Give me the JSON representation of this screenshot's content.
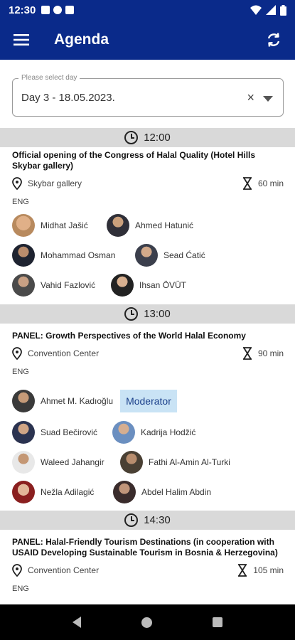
{
  "status": {
    "time": "12:30"
  },
  "app_bar": {
    "title": "Agenda",
    "menu_icon": "menu-icon",
    "refresh_icon": "refresh-icon"
  },
  "day_select": {
    "legend": "Please select day",
    "value": "Day 3 - 18.05.2023.",
    "clear": "×"
  },
  "sessions": [
    {
      "time": "12:00",
      "title": "Official opening of the Congress of Halal Quality (Hotel Hills Skybar gallery)",
      "location": "Skybar gallery",
      "duration": "60 min",
      "language": "ENG",
      "speakers": [
        {
          "name": "Midhat  Jašić"
        },
        {
          "name": "Ahmed  Hatunić"
        },
        {
          "name": "Mohammad  Osman"
        },
        {
          "name": "Sead Ćatić"
        },
        {
          "name": "Vahid Fazlović"
        },
        {
          "name": "Ihsan  ÖVÜT"
        }
      ]
    },
    {
      "time": "13:00",
      "title": "PANEL: Growth Perspectives of the World Halal Economy",
      "location": "Convention Center",
      "duration": "90 min",
      "language": "ENG",
      "moderator_label": "Moderator",
      "speakers": [
        {
          "name": "Ahmet M. Kadıoğlu"
        },
        {
          "name": "Suad Bečirović"
        },
        {
          "name": "Kadrija  Hodžić"
        },
        {
          "name": "Waleed Jahangir"
        },
        {
          "name": "Fathi Al-Amin  Al-Turki"
        },
        {
          "name": "Nežla  Adilagić"
        },
        {
          "name": "Abdel Halim Abdin"
        }
      ]
    },
    {
      "time": "14:30",
      "title": "PANEL: Halal-Friendly Tourism Destinations (in cooperation with USAID Developing Sustainable Tourism in Bosnia & Herzegovina)",
      "location": "Convention Center",
      "duration": "105 min",
      "language": "ENG"
    }
  ],
  "colors": {
    "brand": "#0a2a8a",
    "time_bar": "#d9d9d9",
    "moderator_bg": "#c9e3f5"
  }
}
